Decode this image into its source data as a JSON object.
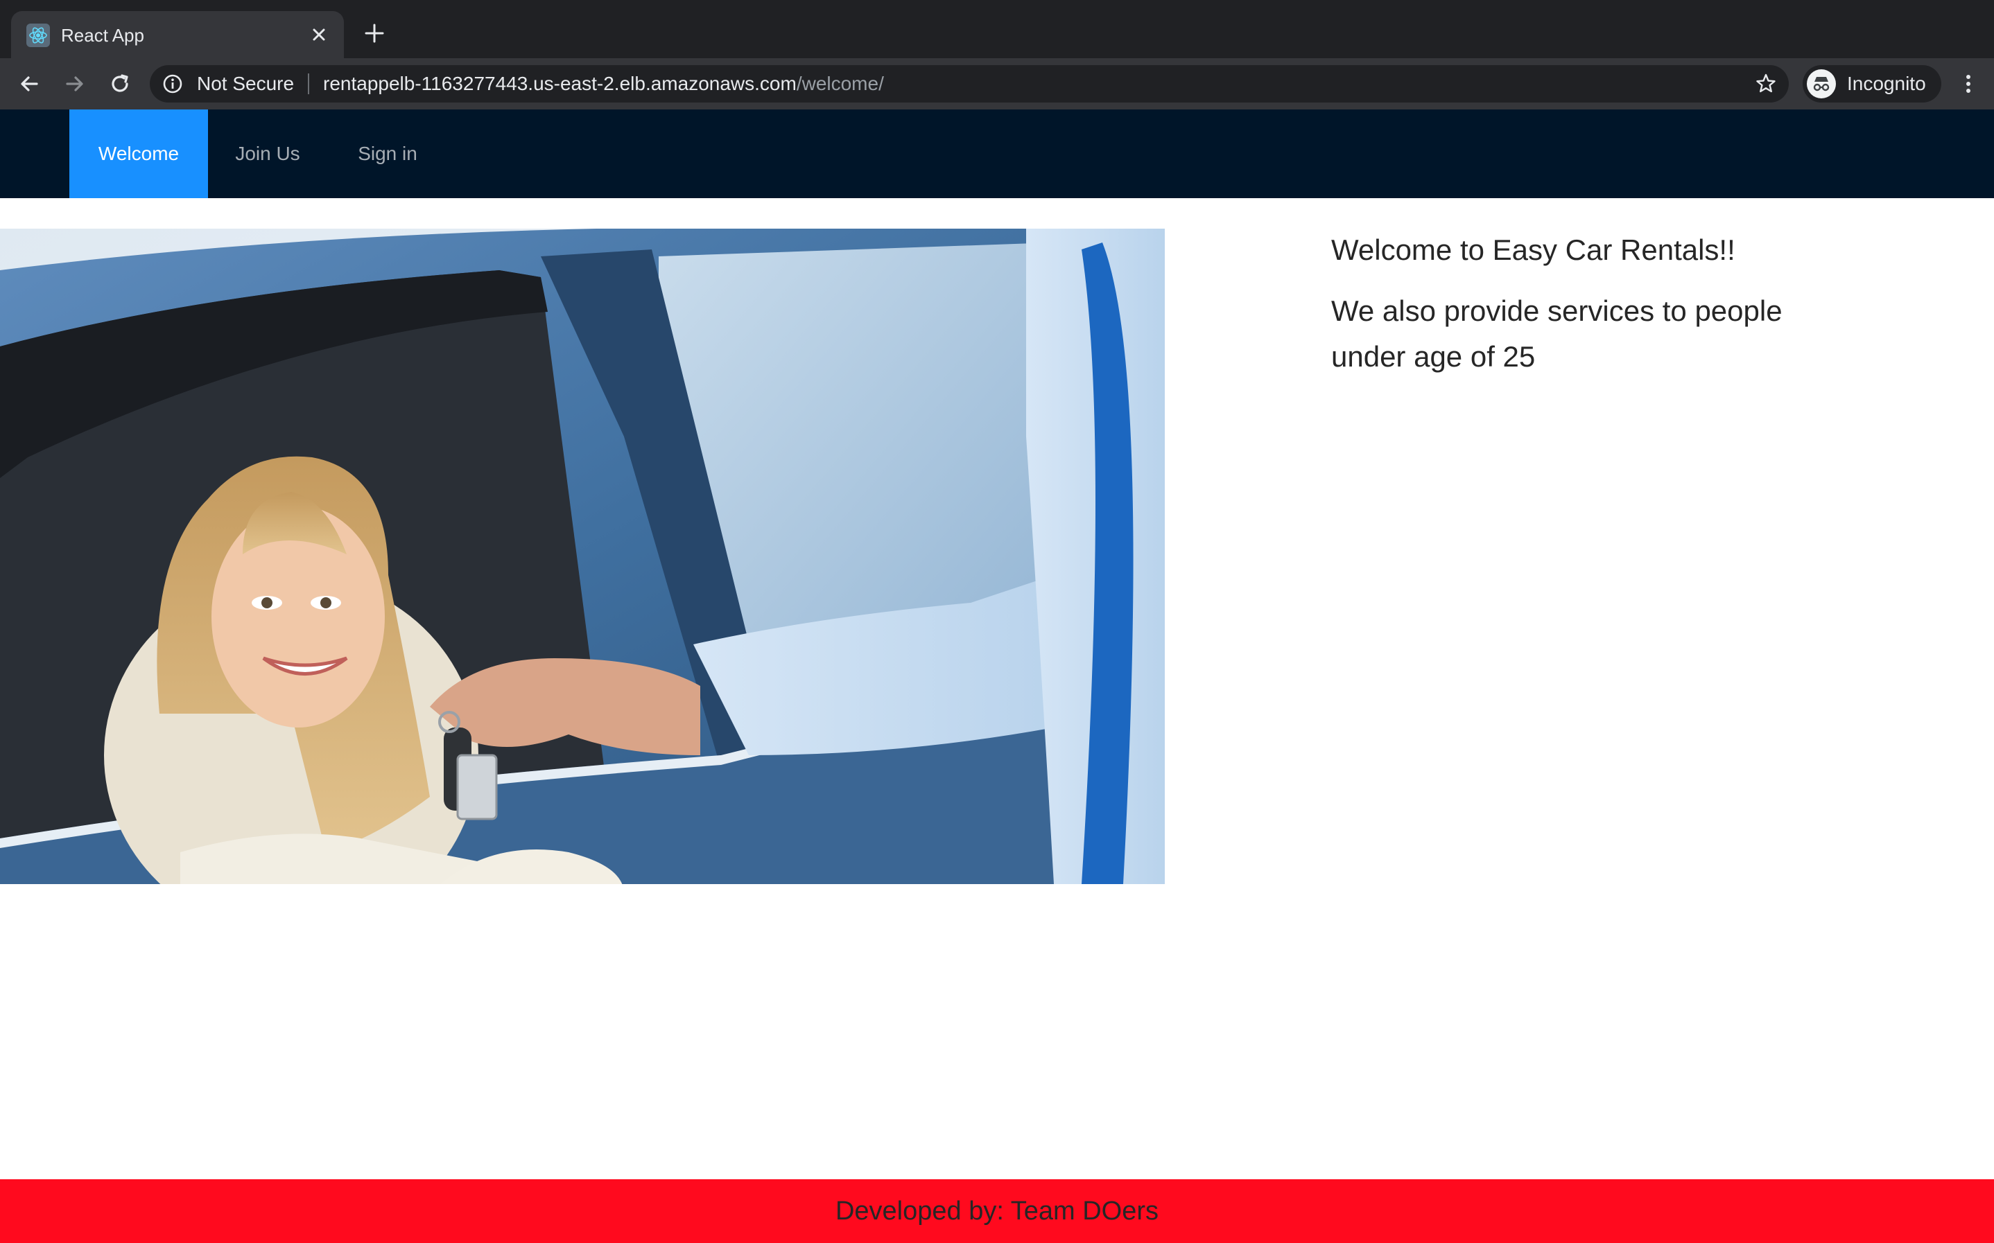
{
  "browser": {
    "tab_title": "React App",
    "security_label": "Not Secure",
    "url_host": "rentappelb-1163277443.us-east-2.elb.amazonaws.com",
    "url_path": "/welcome/",
    "profile_label": "Incognito"
  },
  "nav": {
    "items": [
      {
        "label": "Welcome",
        "active": true
      },
      {
        "label": "Join Us",
        "active": false
      },
      {
        "label": "Sign in",
        "active": false
      }
    ]
  },
  "content": {
    "hero_image": "photo of a smiling woman in a blue car receiving keys",
    "heading": "Welcome to Easy Car Rentals!!",
    "subtext": "We also provide services to people under age of 25"
  },
  "footer": {
    "text": "Developed by: Team DOers"
  },
  "colors": {
    "nav_bg": "#001529",
    "nav_active": "#1890ff",
    "footer_bg": "#ff0a1e"
  }
}
